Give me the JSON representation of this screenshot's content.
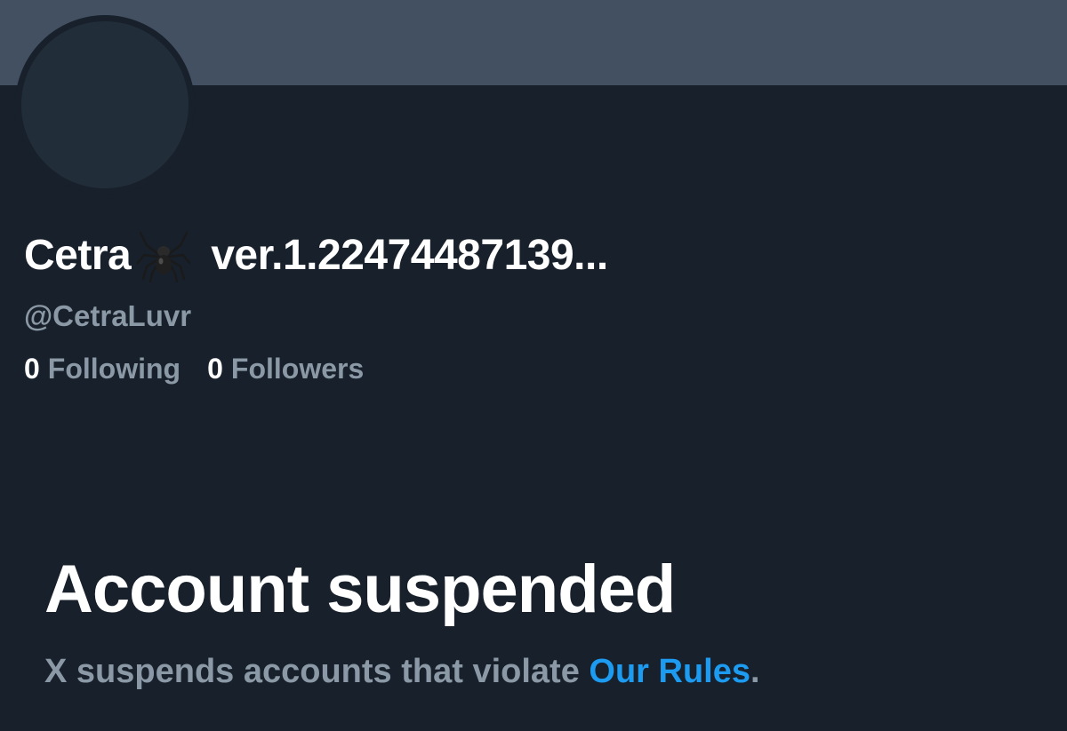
{
  "profile": {
    "display_name": "Cetra",
    "name_suffix": "ver.1.22474487139...",
    "name_emoji_icon": "spider-icon",
    "handle": "@CetraLuvr",
    "following_count": "0",
    "following_label": "Following",
    "followers_count": "0",
    "followers_label": "Followers"
  },
  "notice": {
    "title": "Account suspended",
    "text_prefix": "X suspends accounts that violate ",
    "link_label": "Our Rules",
    "text_suffix": "."
  },
  "colors": {
    "background": "#17202b",
    "banner": "#435061",
    "avatar": "#222d3a",
    "secondary_text": "#8b98a5",
    "link": "#1d9bf0"
  }
}
